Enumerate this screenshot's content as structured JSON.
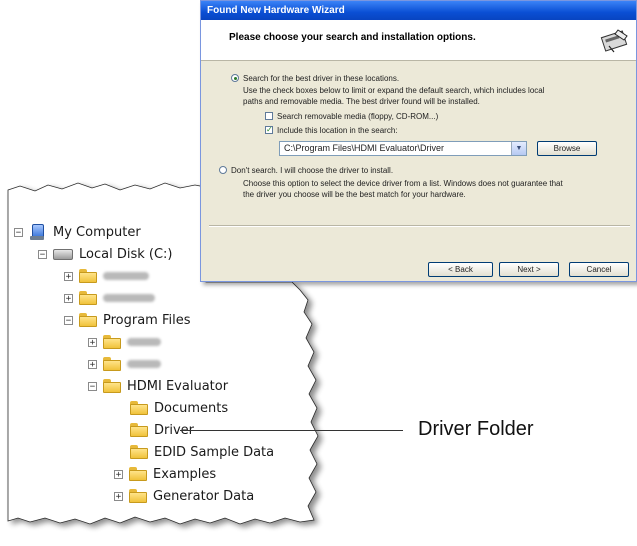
{
  "wizard": {
    "title": "Found New Hardware Wizard",
    "header_title": "Please choose your search and installation options.",
    "option_search": "Search for the best driver in these locations.",
    "option_search_desc_1": "Use the check boxes below to limit or expand the default search, which includes local",
    "option_search_desc_2": "paths and removable media. The best driver found will be installed.",
    "check_removable": "Search removable media (floppy, CD-ROM...)",
    "check_include": "Include this location in the search:",
    "location_value": "C:\\Program Files\\HDMI Evaluator\\Driver",
    "browse_label": "Browse",
    "option_dont_search": "Don't search. I will choose the driver to install.",
    "option_dont_desc_1": "Choose this option to select the device driver from a list. Windows does not guarantee that",
    "option_dont_desc_2": "the driver you choose will be the best match for your hardware.",
    "back_label": "< Back",
    "next_label": "Next >",
    "cancel_label": "Cancel"
  },
  "tree": {
    "my_computer": "My Computer",
    "local_disk": "Local Disk (C:)",
    "program_files": "Program Files",
    "hdmi_evaluator": "HDMI Evaluator",
    "documents": "Documents",
    "driver": "Driver",
    "edid_sample_data": "EDID Sample Data",
    "examples": "Examples",
    "generator_data": "Generator Data",
    "collapse_symbol": "−",
    "expand_symbol": "+"
  },
  "callout": {
    "label": "Driver Folder"
  },
  "colors": {
    "title_bar": "#0a4fd4",
    "dialog_bg": "#ece9d8",
    "folder": "#f0c23b"
  }
}
